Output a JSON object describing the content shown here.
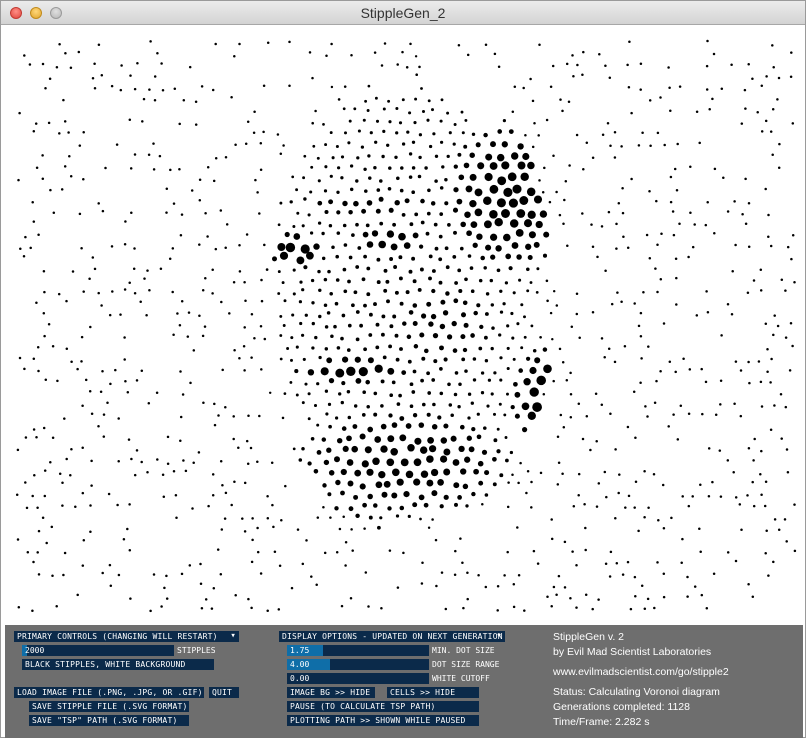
{
  "window": {
    "title": "StippleGen_2"
  },
  "primary": {
    "dropdown_label": "PRIMARY CONTROLS (CHANGING WILL RESTART)",
    "stipples_value": "2000",
    "stipples_label": "STIPPLES",
    "stipples_level": 0.03,
    "color_toggle": "BLACK STIPPLES, WHITE BACKGROUND"
  },
  "file": {
    "load_image": "LOAD IMAGE FILE (.PNG, .JPG, OR .GIF)",
    "quit": "QUIT",
    "save_stipple": "SAVE STIPPLE FILE (.SVG FORMAT)",
    "save_tsp": "SAVE \"TSP\" PATH (.SVG FORMAT)"
  },
  "display": {
    "dropdown_label": "DISPLAY OPTIONS - UPDATED ON NEXT GENERATION",
    "min_dot_size": {
      "value": "1.75",
      "label": "MIN. DOT SIZE",
      "level": 0.25
    },
    "dot_size_range": {
      "value": "4.00",
      "label": "DOT SIZE RANGE",
      "level": 0.3
    },
    "white_cutoff": {
      "value": "0.00",
      "label": "WHITE CUTOFF",
      "level": 0.0
    },
    "image_bg": "IMAGE BG >> HIDE",
    "cells": "CELLS >> HIDE",
    "pause": "PAUSE (TO CALCULATE TSP PATH)",
    "plotting_path": "PLOTTING PATH >> SHOWN WHILE PAUSED"
  },
  "info": {
    "app_name": "StippleGen v. 2",
    "author": "by Evil Mad Scientist Laboratories",
    "url": "www.evilmadscientist.com/go/stipple2",
    "status": "Status: Calculating Voronoi diagram",
    "generations": "Generations completed: 1128",
    "time_frame": "Time/Frame: 2.282 s"
  },
  "colors": {
    "panel_bg": "#6e6e6e",
    "control_bg": "#0b2a4a",
    "slider_fill": "#0f6ea8",
    "dot": "#000000"
  }
}
